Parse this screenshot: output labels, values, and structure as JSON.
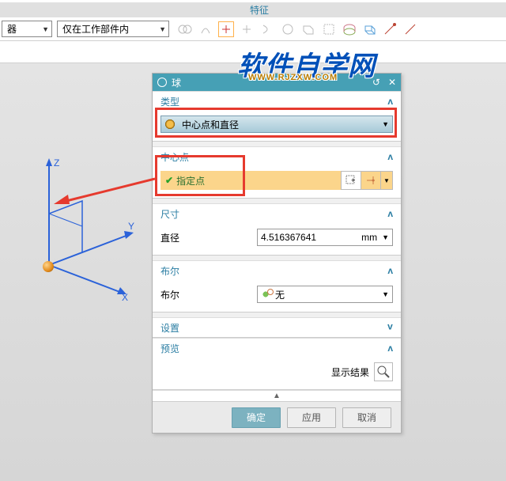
{
  "top_tab": "特征",
  "toolbar": {
    "combo1": "器",
    "combo2": "仅在工作部件内"
  },
  "watermark": {
    "main": "软件自学网",
    "sub": "WWW.RJZXW.COM"
  },
  "dialog": {
    "title": "球",
    "sections": {
      "type": {
        "label": "类型",
        "value": "中心点和直径"
      },
      "center": {
        "label": "中心点",
        "point_label": "指定点"
      },
      "size": {
        "label": "尺寸",
        "diameter_label": "直径",
        "diameter_value": "4.516367641",
        "unit": "mm"
      },
      "bool": {
        "label": "布尔",
        "field_label": "布尔",
        "value": "无"
      },
      "settings": {
        "label": "设置"
      },
      "preview": {
        "label": "预览",
        "show_result": "显示结果"
      }
    },
    "buttons": {
      "ok": "确定",
      "apply": "应用",
      "cancel": "取消"
    }
  },
  "axes": {
    "x": "X",
    "y": "Y",
    "z": "Z"
  }
}
